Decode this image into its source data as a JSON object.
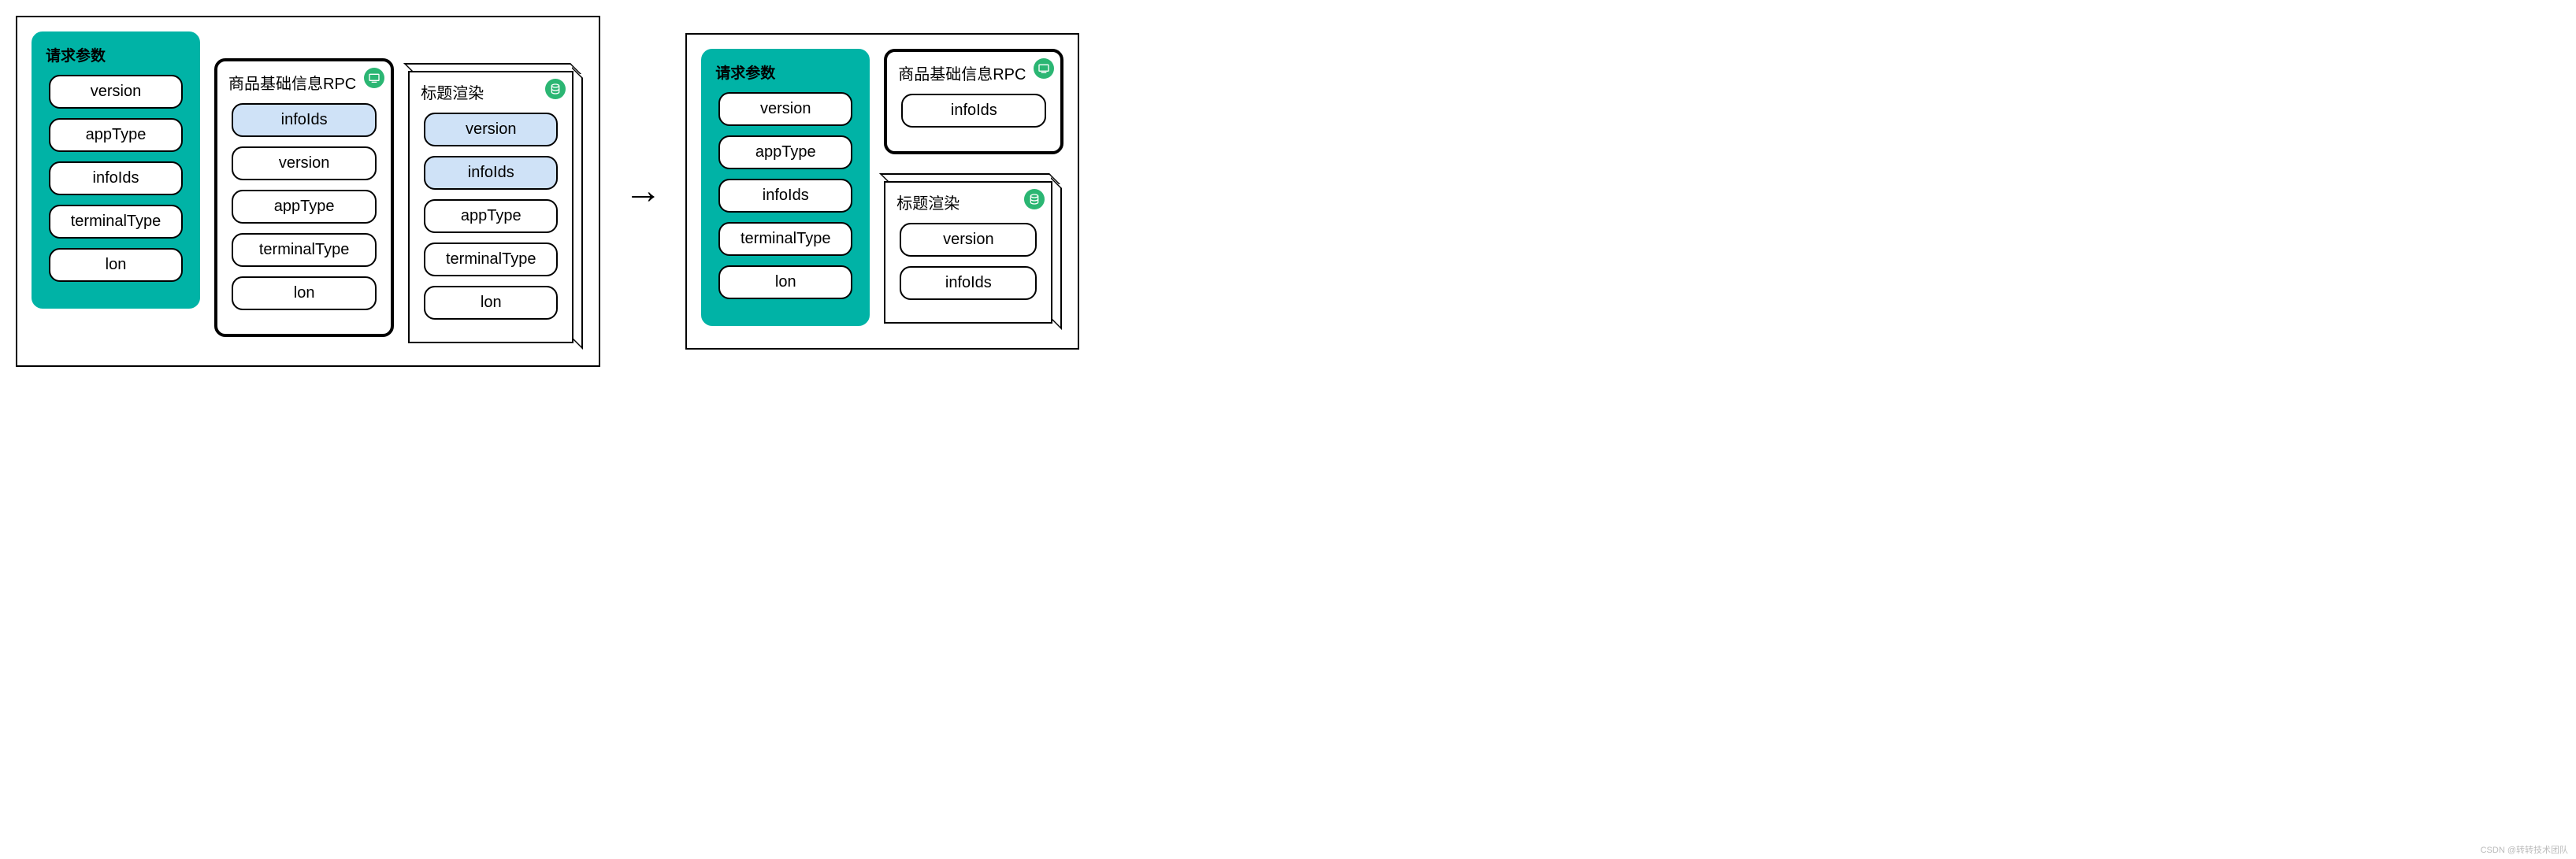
{
  "left": {
    "request": {
      "title": "请求参数",
      "items": [
        "version",
        "appType",
        "infoIds",
        "terminalType",
        "lon"
      ]
    },
    "rpc": {
      "title": "商品基础信息RPC",
      "items": [
        {
          "label": "infoIds",
          "highlight": true
        },
        {
          "label": "version",
          "highlight": false
        },
        {
          "label": "appType",
          "highlight": false
        },
        {
          "label": "terminalType",
          "highlight": false
        },
        {
          "label": "lon",
          "highlight": false
        }
      ]
    },
    "render": {
      "title": "标题渲染",
      "items": [
        {
          "label": "version",
          "highlight": true
        },
        {
          "label": "infoIds",
          "highlight": true
        },
        {
          "label": "appType",
          "highlight": false
        },
        {
          "label": "terminalType",
          "highlight": false
        },
        {
          "label": "lon",
          "highlight": false
        }
      ]
    }
  },
  "arrow": "→",
  "right": {
    "request": {
      "title": "请求参数",
      "items": [
        "version",
        "appType",
        "infoIds",
        "terminalType",
        "lon"
      ]
    },
    "rpc": {
      "title": "商品基础信息RPC",
      "items": [
        "infoIds"
      ]
    },
    "render": {
      "title": "标题渲染",
      "items": [
        "version",
        "infoIds"
      ]
    }
  },
  "watermark": "CSDN @转转技术团队"
}
